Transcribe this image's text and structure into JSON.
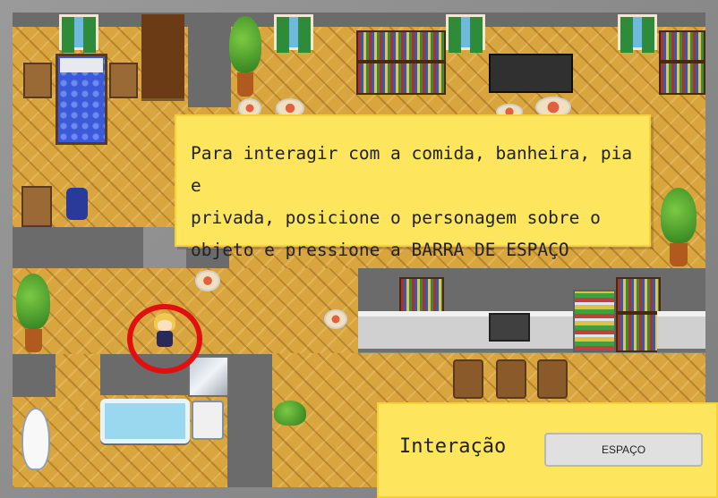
{
  "game": {
    "scene": "house-interior",
    "player": {
      "hair_color": "#f0c850",
      "highlight_color": "#e01010"
    },
    "colors": {
      "floor": "#d9a53f",
      "wall": "#6b6b6b",
      "dialog_bg": "#fde55d"
    }
  },
  "dialog": {
    "text": "Para interagir com a comida, banheira, pia e\nprivada, posicione o personagem sobre o\nobjeto e pressione a BARRA DE ESPAÇO"
  },
  "interaction": {
    "label": "Interação",
    "key_label": "ESPAÇO"
  }
}
